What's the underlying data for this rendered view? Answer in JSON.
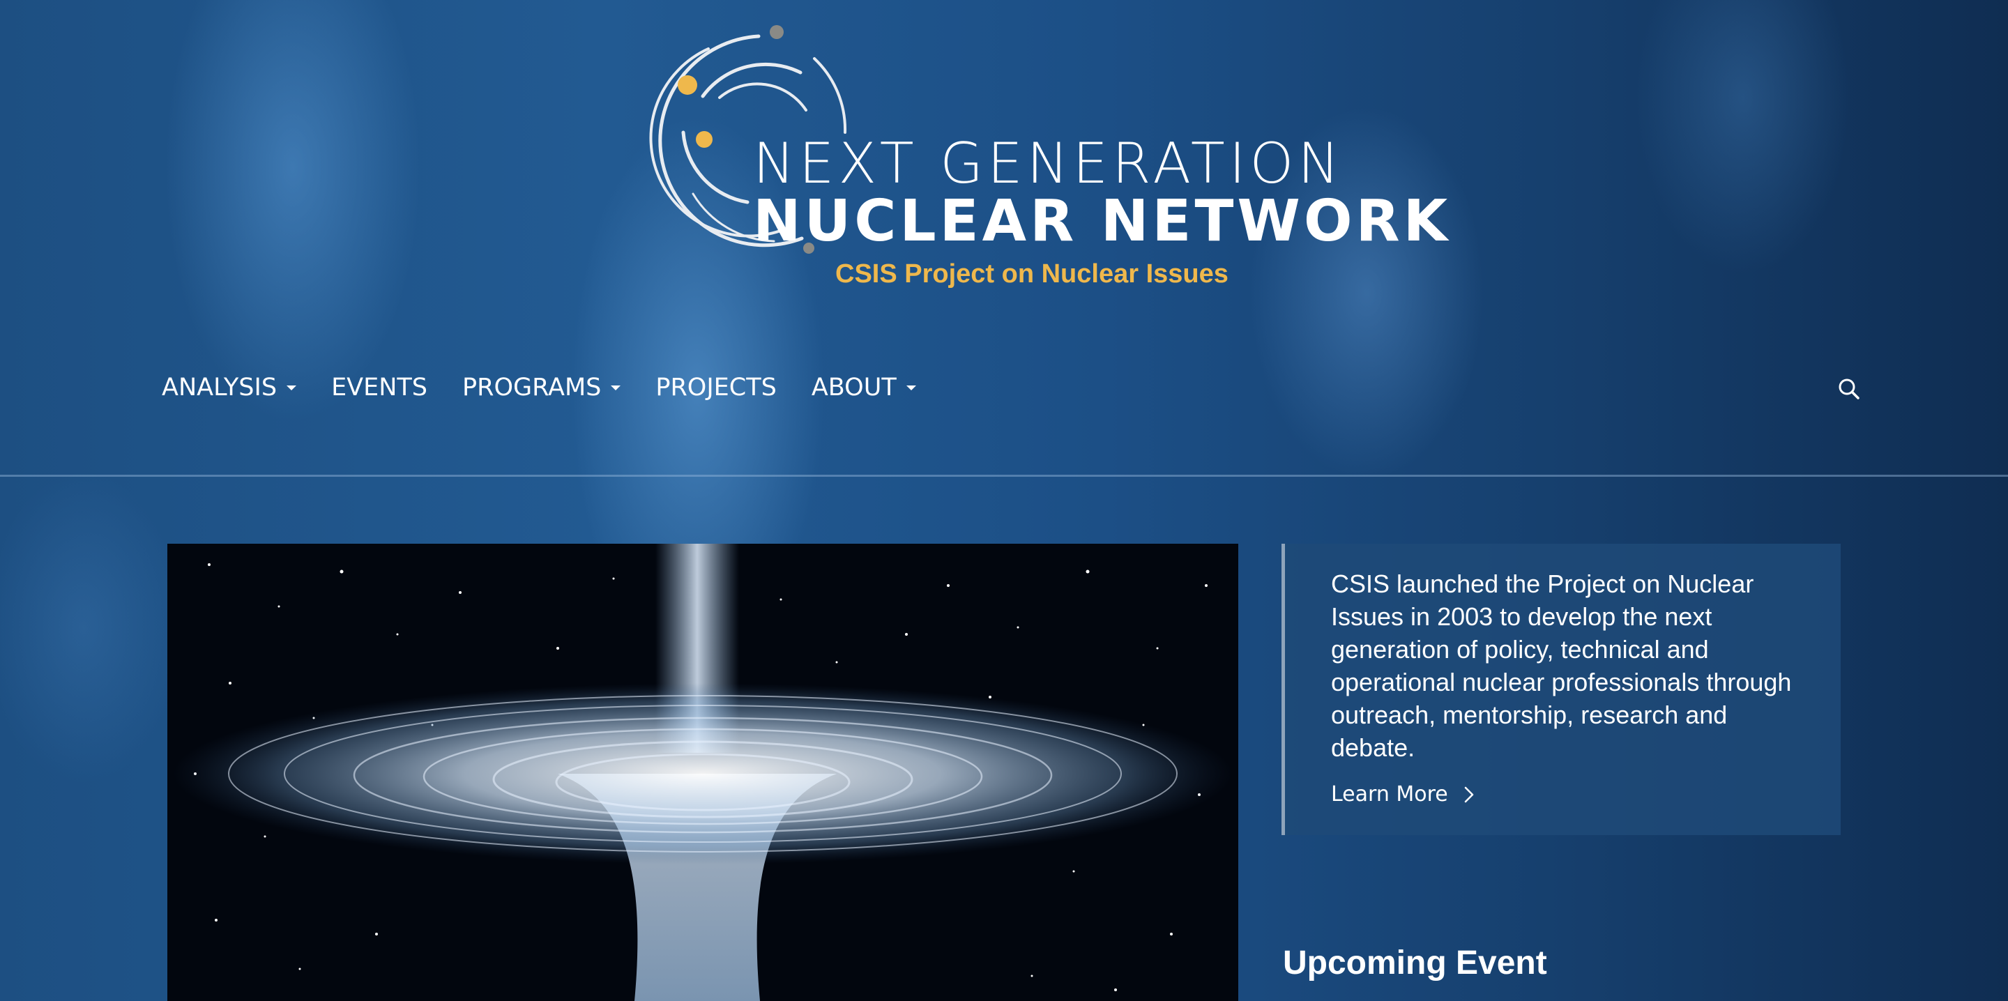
{
  "branding": {
    "logo_line1": "NEXT GENERATION",
    "logo_line2": "NUCLEAR NETWORK",
    "tagline": "CSIS Project on Nuclear Issues",
    "colors": {
      "accent_gold": "#efb84c",
      "logo_gray": "#8a8a86",
      "text": "#ffffff"
    }
  },
  "nav": {
    "items": [
      {
        "label": "ANALYSIS",
        "has_dropdown": true
      },
      {
        "label": "EVENTS",
        "has_dropdown": false
      },
      {
        "label": "PROGRAMS",
        "has_dropdown": true
      },
      {
        "label": "PROJECTS",
        "has_dropdown": false
      },
      {
        "label": "ABOUT",
        "has_dropdown": true
      }
    ],
    "search_icon": "search-icon"
  },
  "hero": {
    "image_icon": "vortex-image",
    "info": {
      "text": "CSIS launched the Project on Nuclear Issues in 2003 to develop the next generation of policy, technical and operational nuclear professionals through outreach, mentorship, research and debate.",
      "link_label": "Learn More",
      "link_icon": "chevron-right-icon"
    }
  },
  "upcoming": {
    "title": "Upcoming Event"
  }
}
